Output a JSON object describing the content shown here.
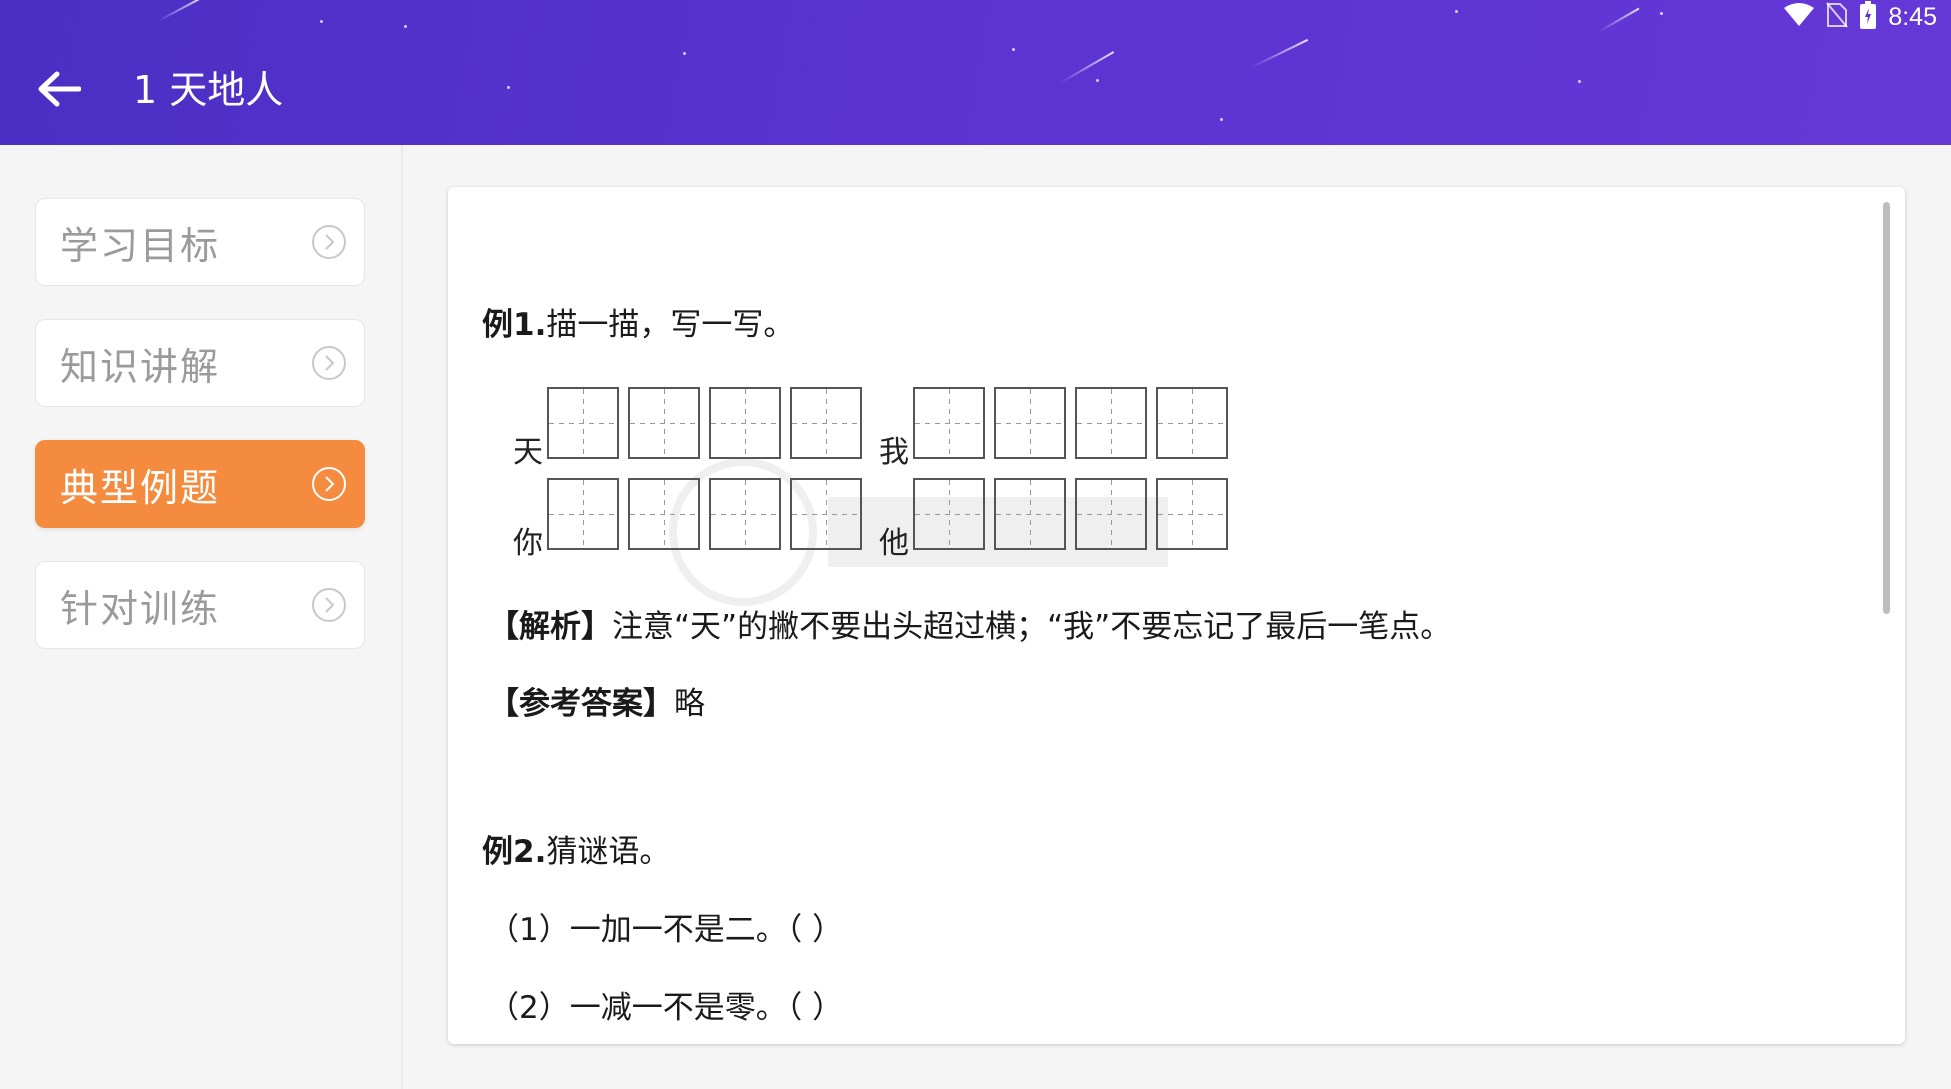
{
  "status_bar": {
    "time": "8:45",
    "icons": [
      "wifi-icon",
      "no-sim-icon",
      "battery-icon"
    ]
  },
  "header": {
    "title": "1 天地人",
    "back_icon": "arrow-left-icon"
  },
  "sidebar": {
    "items": [
      {
        "label": "学习目标",
        "active": false
      },
      {
        "label": "知识讲解",
        "active": false
      },
      {
        "label": "典型例题",
        "active": true
      },
      {
        "label": "针对训练",
        "active": false
      }
    ]
  },
  "colors": {
    "header": "#5a33d0",
    "accent": "#f48b3e"
  },
  "content": {
    "ex1": {
      "label": "例1.",
      "text": "描一描，写一写。",
      "grid_chars": [
        "天",
        "我",
        "你",
        "他"
      ],
      "analysis_label": "【解析】",
      "analysis_text": "注意“天”的撇不要出头超过横；“我”不要忘记了最后一笔点。",
      "answer_label": "【参考答案】",
      "answer_text": "略"
    },
    "ex2": {
      "label": "例2.",
      "text": "猜谜语。",
      "items": [
        "（1）一加一不是二。（ ）",
        "（2）一减一不是零。（ ）"
      ]
    }
  }
}
